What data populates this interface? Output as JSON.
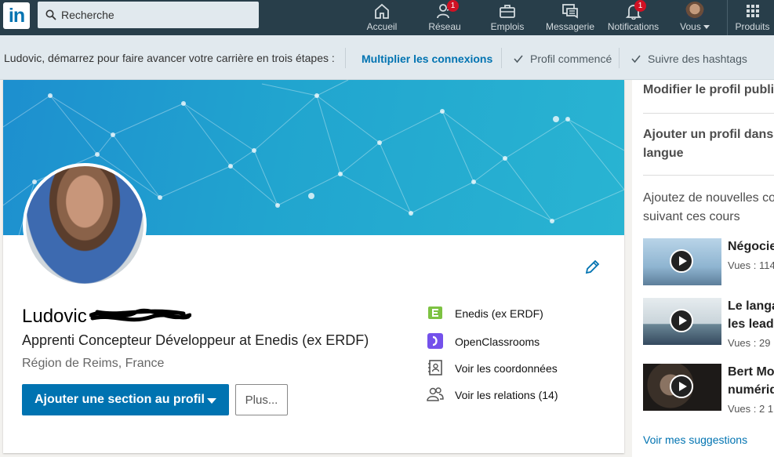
{
  "nav": {
    "logo_text": "in",
    "search_placeholder": "Recherche",
    "items": [
      {
        "label": "Accueil",
        "icon": "home-icon"
      },
      {
        "label": "Réseau",
        "icon": "network-icon",
        "badge": "1"
      },
      {
        "label": "Emplois",
        "icon": "briefcase-icon"
      },
      {
        "label": "Messagerie",
        "icon": "messaging-icon"
      },
      {
        "label": "Notifications",
        "icon": "bell-icon",
        "badge": "1"
      },
      {
        "label": "Vous",
        "icon": "avatar"
      },
      {
        "label": "Produits",
        "icon": "grid-icon"
      }
    ]
  },
  "steps": {
    "intro": "Ludovic, démarrez pour faire avancer votre carrière en trois étapes :",
    "active": "Multiplier les connexions",
    "done1": "Profil commencé",
    "done2": "Suivre des hashtags"
  },
  "profile": {
    "name": "Ludovic",
    "headline": "Apprenti Concepteur Développeur at Enedis (ex ERDF)",
    "location": "Région de Reims, France",
    "add_section": "Ajouter une section au profil",
    "more": "Plus...",
    "links": [
      {
        "label": "Enedis (ex ERDF)",
        "icon": "enedis-logo-icon"
      },
      {
        "label": "OpenClassrooms",
        "icon": "openclassrooms-logo-icon"
      },
      {
        "label": "Voir les coordonnées",
        "icon": "contact-card-icon"
      },
      {
        "label": "Voir les relations (14)",
        "icon": "people-icon"
      }
    ]
  },
  "rail": {
    "edit_public": "Modifier le profil public",
    "add_lang_1": "Ajouter un profil dans u",
    "add_lang_2": "langue",
    "courses_intro_1": "Ajoutez de nouvelles co",
    "courses_intro_2": "suivant ces cours",
    "courses": [
      {
        "title_1": "Négocie",
        "title_2": "",
        "views": "Vues : 114"
      },
      {
        "title_1": "Le langa",
        "title_2": "les leade",
        "views": "Vues : 29"
      },
      {
        "title_1": "Bert Mo",
        "title_2": "numériq",
        "views": "Vues : 2 1"
      }
    ],
    "suggestions": "Voir mes suggestions"
  },
  "colors": {
    "nav_bg": "#283e4a",
    "accent": "#0073b1",
    "badge": "#d11124"
  }
}
